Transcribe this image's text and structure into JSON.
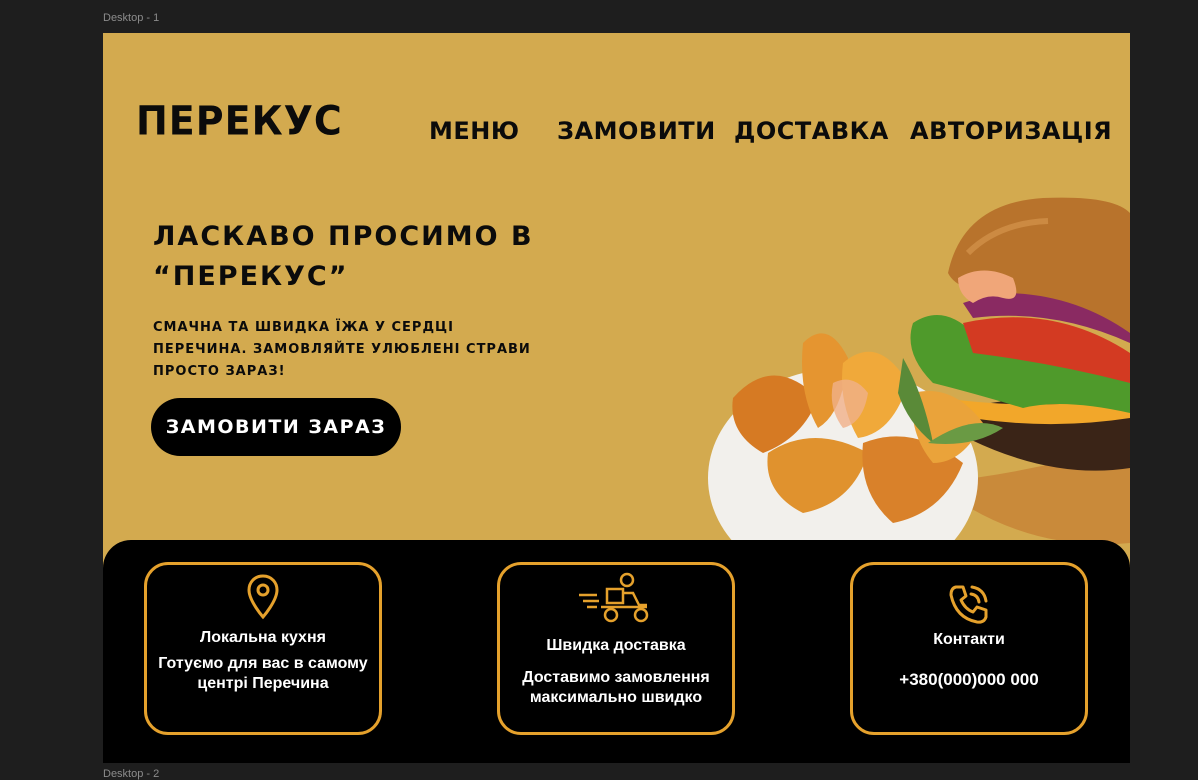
{
  "canvas": {
    "frame_label": "Desktop - 1",
    "next_frame_label": "Desktop - 2"
  },
  "header": {
    "logo": "ПЕРЕКУС",
    "nav": [
      "МЕНЮ",
      "ЗАМОВИТИ",
      "ДОСТАВКА",
      "АВТОРИЗАЦІЯ"
    ]
  },
  "hero": {
    "title": "ЛАСКАВО ПРОСИМО В “ПЕРЕКУС”",
    "subtitle": "СМАЧНА ТА ШВИДКА ЇЖА У СЕРДЦІ ПЕРЕЧИНА. ЗАМОВЛЯЙТЕ УЛЮБЛЕНІ СТРАВИ ПРОСТО ЗАРАЗ!",
    "cta": "ЗАМОВИТИ ЗАРАЗ"
  },
  "features": [
    {
      "icon": "location-pin-icon",
      "title": "Локальна кухня",
      "text": "Готуємо для вас в самому центрі Перечина"
    },
    {
      "icon": "delivery-scooter-icon",
      "title": "Швидка доставка",
      "text": "Доставимо замовлення максимально швидко"
    },
    {
      "icon": "phone-icon",
      "title": "Контакти",
      "text": "+380(000)000 000"
    }
  ],
  "colors": {
    "background": "#d3aa4f",
    "accent": "#e5a12c",
    "dark": "#000000",
    "canvas": "#1e1e1e"
  }
}
